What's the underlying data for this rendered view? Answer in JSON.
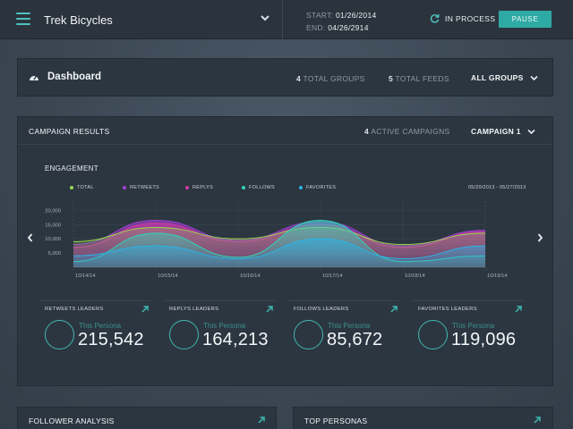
{
  "topbar": {
    "menu_icon": "hamburger-icon",
    "title": "Trek Bicycles",
    "start_label": "START:",
    "start_date": "01/26/2014",
    "end_label": "END:",
    "end_date": "04/26/2914",
    "status": "IN PROCESS",
    "pause_label": "PAUSE",
    "accent": "#2eaaa4"
  },
  "dashboard": {
    "title": "Dashboard",
    "groups_count": "4",
    "groups_label": "TOTAL GROUPS",
    "feeds_count": "5",
    "feeds_label": "TOTAL FEEDS",
    "filter": "ALL GROUPS"
  },
  "campaign": {
    "title": "CAMPAIGN RESULTS",
    "active_count": "4",
    "active_label": "ACTIVE CAMPAIGNS",
    "selector": "CAMPAIGN 1",
    "engagement_title": "ENGAGEMENT",
    "date_range": "05/20/2013 - 05/27/2013"
  },
  "chart_data": {
    "type": "area",
    "title": "ENGAGEMENT",
    "xlabel": "",
    "ylabel": "",
    "x": [
      "10/14/14",
      "10/15/14",
      "10/16/14",
      "10/17/14",
      "10/18/14",
      "10/19/14"
    ],
    "yticks": [
      "20,000",
      "15,000",
      "10,000",
      "5,000"
    ],
    "ylim": [
      0,
      22000
    ],
    "grid": true,
    "legend_position": "top",
    "series": [
      {
        "name": "TOTAL",
        "color": "#9bd94c",
        "values": [
          9000,
          14000,
          10000,
          14000,
          8000,
          12000
        ]
      },
      {
        "name": "RETWEETS",
        "color": "#a13fd4",
        "values": [
          8000,
          16500,
          9500,
          16000,
          7500,
          13000
        ]
      },
      {
        "name": "REPLYS",
        "color": "#d23aa6",
        "values": [
          7000,
          15500,
          9000,
          15000,
          7000,
          12500
        ]
      },
      {
        "name": "FOLLOWS",
        "color": "#2fd5b9",
        "values": [
          2000,
          12000,
          3500,
          16500,
          2000,
          4000
        ]
      },
      {
        "name": "FAVORITES",
        "color": "#2bb3e6",
        "values": [
          4000,
          7500,
          3000,
          10000,
          3000,
          7500
        ]
      }
    ]
  },
  "leaders": [
    {
      "title": "RETWEETS LEADERS",
      "sub": "This Persona",
      "value": "215,542"
    },
    {
      "title": "REPLYS LEADERS",
      "sub": "This Persona",
      "value": "164,213"
    },
    {
      "title": "FOLLOWS LEADERS",
      "sub": "This Persona",
      "value": "85,672"
    },
    {
      "title": "FAVORITES LEADERS",
      "sub": "This Persona",
      "value": "119,096"
    }
  ],
  "bottom": {
    "follower_title": "FOLLOWER ANALYSIS",
    "personas_title": "TOP PERSONAS"
  }
}
